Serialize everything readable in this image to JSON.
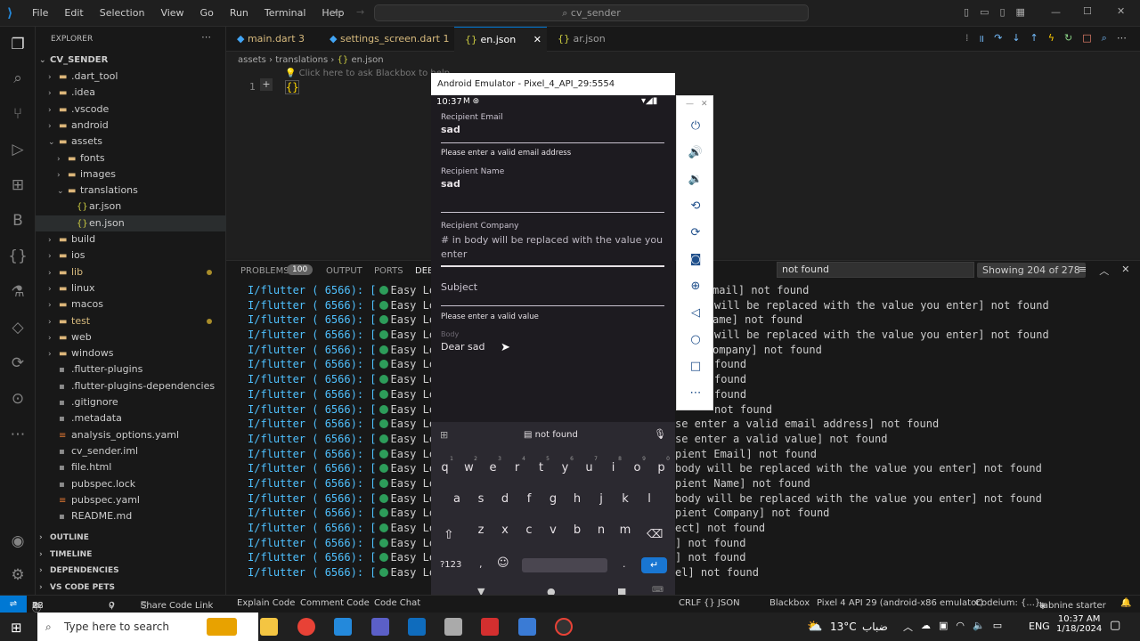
{
  "titlebar": {
    "menu": [
      "File",
      "Edit",
      "Selection",
      "View",
      "Go",
      "Run",
      "Terminal",
      "Help"
    ],
    "search": "cv_sender"
  },
  "sidebar": {
    "header": "EXPLORER",
    "root": "CV_SENDER",
    "items": [
      {
        "label": ".dart_tool",
        "type": "folder",
        "depth": 1
      },
      {
        "label": ".idea",
        "type": "folder",
        "depth": 1
      },
      {
        "label": ".vscode",
        "type": "folder",
        "depth": 1
      },
      {
        "label": "android",
        "type": "folder",
        "depth": 1
      },
      {
        "label": "assets",
        "type": "folder-open",
        "depth": 1
      },
      {
        "label": "fonts",
        "type": "folder",
        "depth": 2
      },
      {
        "label": "images",
        "type": "folder",
        "depth": 2
      },
      {
        "label": "translations",
        "type": "folder-open",
        "depth": 2
      },
      {
        "label": "ar.json",
        "type": "json",
        "depth": 3
      },
      {
        "label": "en.json",
        "type": "json",
        "depth": 3
      },
      {
        "label": "build",
        "type": "folder",
        "depth": 1
      },
      {
        "label": "ios",
        "type": "folder",
        "depth": 1
      },
      {
        "label": "lib",
        "type": "folder",
        "depth": 1
      },
      {
        "label": "linux",
        "type": "folder",
        "depth": 1
      },
      {
        "label": "macos",
        "type": "folder",
        "depth": 1
      },
      {
        "label": "test",
        "type": "folder",
        "depth": 1
      },
      {
        "label": "web",
        "type": "folder",
        "depth": 1
      },
      {
        "label": "windows",
        "type": "folder",
        "depth": 1
      },
      {
        "label": ".flutter-plugins",
        "type": "file",
        "depth": 1
      },
      {
        "label": ".flutter-plugins-dependencies",
        "type": "file",
        "depth": 1
      },
      {
        "label": ".gitignore",
        "type": "file",
        "depth": 1
      },
      {
        "label": ".metadata",
        "type": "file",
        "depth": 1
      },
      {
        "label": "analysis_options.yaml",
        "type": "yaml",
        "depth": 1
      },
      {
        "label": "cv_sender.iml",
        "type": "file",
        "depth": 1
      },
      {
        "label": "file.html",
        "type": "file",
        "depth": 1
      },
      {
        "label": "pubspec.lock",
        "type": "file",
        "depth": 1
      },
      {
        "label": "pubspec.yaml",
        "type": "yaml",
        "depth": 1
      },
      {
        "label": "README.md",
        "type": "file",
        "depth": 1
      }
    ],
    "sections": [
      "OUTLINE",
      "TIMELINE",
      "DEPENDENCIES",
      "VS CODE PETS"
    ]
  },
  "tabs": [
    {
      "label": "main.dart",
      "badge": "3"
    },
    {
      "label": "settings_screen.dart",
      "badge": "1"
    },
    {
      "label": "en.json",
      "badge": ""
    },
    {
      "label": "ar.json",
      "badge": ""
    }
  ],
  "editor": {
    "breadcrumb": [
      "assets",
      "translations",
      "en.json"
    ],
    "hint": "Click here to ask Blackbox to help",
    "line_number": "1",
    "code": "{}"
  },
  "panel": {
    "tabs": [
      "PROBLEMS",
      "OUTPUT",
      "PORTS",
      "DEBU"
    ],
    "problems_count": "100",
    "find_value": "not found",
    "find_count": "Showing 204 of 278",
    "log_prefix": "I/flutter ( 6566): [",
    "log_tag": "Easy Loca",
    "log_tails": [
      "mail] not found",
      "will be replaced with the value you enter] not found",
      "ame] not found",
      "will be replaced with the value you enter] not found",
      "ompany] not found",
      "found",
      "found",
      "found",
      "not found",
      "se enter a valid email address] not found",
      "se enter a valid value] not found",
      "pient Email] not found",
      "body will be replaced with the value you enter] not found",
      "pient Name] not found",
      "body will be replaced with the value you enter] not found",
      "pient Company] not found",
      "ect] not found",
      "] not found",
      "] not found",
      "el] not found"
    ]
  },
  "emulator": {
    "title": "Android Emulator - Pixel_4_API_29:5554",
    "time": "10:37",
    "fields": {
      "email_label": "Recipient Email",
      "email_value": "sad",
      "email_error": "Please enter a valid email address",
      "name_label": "Recipient Name",
      "name_value": "sad",
      "company_label": "Recipient Company",
      "company_hint": "# in body will be replaced with the value you enter",
      "subject_hint": "Subject",
      "subject_error": "Please enter a valid value",
      "body_label": "Body",
      "body_value": "Dear sad"
    },
    "keyboard": {
      "suggestion": "not found",
      "row1": [
        "q",
        "w",
        "e",
        "r",
        "t",
        "y",
        "u",
        "i",
        "o",
        "p"
      ],
      "row1_nums": [
        "1",
        "2",
        "3",
        "4",
        "5",
        "6",
        "7",
        "8",
        "9",
        "0"
      ],
      "row2": [
        "a",
        "s",
        "d",
        "f",
        "g",
        "h",
        "j",
        "k",
        "l"
      ],
      "row3": [
        "z",
        "x",
        "c",
        "v",
        "b",
        "n",
        "m"
      ],
      "sym": "?123",
      "comma": ",",
      "period": "."
    }
  },
  "status": {
    "problems": "0",
    "warnings": "22",
    "info": "78",
    "ports": "0",
    "items": [
      "Share Code Link",
      "Explain Code",
      "Comment Code",
      "Code Chat"
    ],
    "right": [
      "CRLF",
      "{} JSON",
      "Blackbox",
      "Pixel 4 API 29 (android-x86 emulator)",
      "Codeium: {...}",
      "tabnine starter"
    ]
  },
  "taskbar": {
    "search": "Type here to search",
    "weather": "13°C",
    "weather_text": "ضباب",
    "lang": "ENG",
    "time": "10:37 AM",
    "date": "1/18/2024"
  },
  "colors": {
    "accent": "#0078d4",
    "folder": "#dcb67a",
    "json": "#cbcb41",
    "git_dot": "#a98d2a"
  }
}
